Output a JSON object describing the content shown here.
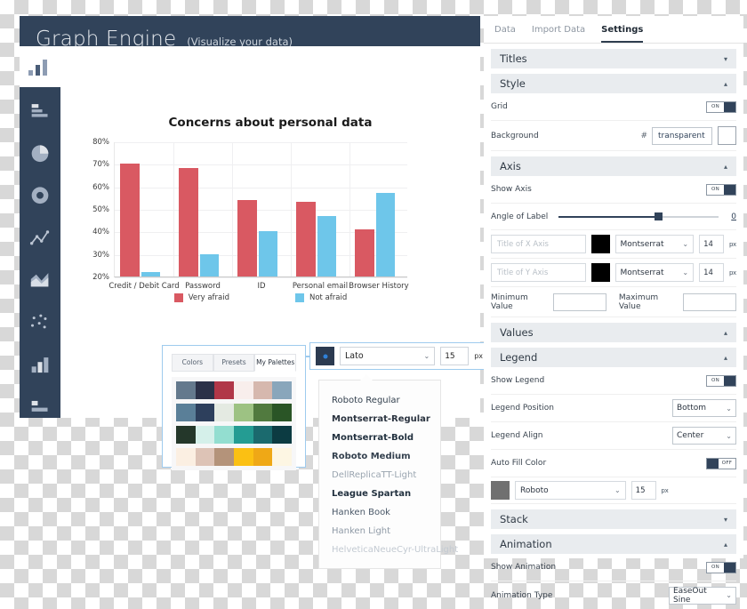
{
  "app": {
    "title": "Graph Engine",
    "subtitle": "(Visualize your data)",
    "sidebar_icons": [
      "bar-list-icon",
      "pie-chart-icon",
      "donut-chart-icon",
      "line-chart-icon",
      "area-chart-icon",
      "scatter-chart-icon",
      "column-chart-icon",
      "table-icon"
    ]
  },
  "chart_data": {
    "type": "bar",
    "title": "Concerns about personal data",
    "xlabel": "",
    "ylabel": "",
    "categories": [
      "Credit / Debit Card",
      "Password",
      "ID",
      "Personal email",
      "Browser History"
    ],
    "series": [
      {
        "name": "Very afraid",
        "color": "#d95962",
        "values": [
          70,
          68,
          54,
          53,
          41
        ]
      },
      {
        "name": "Not afraid",
        "color": "#6ec6ea",
        "values": [
          22,
          30,
          40,
          47,
          57
        ]
      }
    ],
    "ylim": [
      20,
      80
    ],
    "yticks": [
      "80%",
      "70%",
      "60%",
      "50%",
      "40%",
      "30%",
      "20%"
    ],
    "grid": true,
    "legend_position": "bottom",
    "legend_align": "center"
  },
  "palette_popup": {
    "tabs": [
      {
        "label": "Colors",
        "active": false
      },
      {
        "label": "Presets",
        "active": false
      },
      {
        "label": "My Palettes",
        "active": true
      }
    ],
    "rows": [
      [
        "#64798d",
        "#2b3148",
        "#b13748",
        "#f8eeec",
        "#d6b8ae",
        "#89a6bb"
      ],
      [
        "#5a7f98",
        "#2d3f5c",
        "#e4eae2",
        "#9dc283",
        "#517a3f",
        "#2a5526"
      ],
      [
        "#24372a",
        "#d5f0ea",
        "#93ded0",
        "#249c93",
        "#1b6a6e",
        "#0c3b42"
      ],
      [
        "#fbefe2",
        "#ddc3b6",
        "#b4937a",
        "#fbc013",
        "#efa816",
        "#fdf6e3"
      ]
    ]
  },
  "font_field": {
    "color": "#2b3a50",
    "font": "Lato",
    "size": "15",
    "unit": "px"
  },
  "font_list": [
    {
      "label": "Roboto Regular",
      "weight": "normal",
      "color": "#33404e"
    },
    {
      "label": "Montserrat-Regular",
      "weight": "bold",
      "color": "#2b3440"
    },
    {
      "label": "Montserrat-Bold",
      "weight": "bold",
      "color": "#22313f"
    },
    {
      "label": "Roboto Medium",
      "weight": "bold",
      "color": "#33404e"
    },
    {
      "label": "DellReplicaTT-Light",
      "weight": "normal",
      "color": "#9aa5b0"
    },
    {
      "label": "League Spartan",
      "weight": "bold",
      "color": "#22313f"
    },
    {
      "label": "Hanken Book",
      "weight": "normal",
      "color": "#4a5868"
    },
    {
      "label": "Hanken Light",
      "weight": "normal",
      "color": "#8f9aa6"
    },
    {
      "label": "HelveticaNeueCyr-UltraLight",
      "weight": "normal",
      "color": "#c3cad2"
    }
  ],
  "panel": {
    "tabs": [
      {
        "label": "Data",
        "active": false
      },
      {
        "label": "Import Data",
        "active": false
      },
      {
        "label": "Settings",
        "active": true
      }
    ],
    "sections": {
      "titles": {
        "label": "Titles",
        "caret": "▾"
      },
      "style": {
        "label": "Style",
        "caret": "▴"
      },
      "axis": {
        "label": "Axis",
        "caret": "▴"
      },
      "values": {
        "label": "Values",
        "caret": "▴"
      },
      "legend": {
        "label": "Legend",
        "caret": "▴"
      },
      "stack": {
        "label": "Stack",
        "caret": "▾"
      },
      "animation": {
        "label": "Animation",
        "caret": "▴"
      }
    },
    "style": {
      "grid_label": "Grid",
      "grid_toggle": "ON",
      "background_label": "Background",
      "hash": "#",
      "background_value": "transparent"
    },
    "axis": {
      "show_axis_label": "Show Axis",
      "show_axis_toggle": "ON",
      "angle_label": "Angle of Label",
      "angle_value": "0",
      "x_title_placeholder": "Title of X Axis",
      "x_font": "Montserrat",
      "x_size": "14",
      "x_unit": "px",
      "y_title_placeholder": "Title of Y Axis",
      "y_font": "Montserrat",
      "y_size": "14",
      "y_unit": "px",
      "min_label": "Minimum Value",
      "min_value": "",
      "max_label": "Maximum Value",
      "max_value": ""
    },
    "legend": {
      "show_label": "Show Legend",
      "show_toggle": "ON",
      "position_label": "Legend Position",
      "position_value": "Bottom",
      "align_label": "Legend Align",
      "align_value": "Center",
      "autofill_label": "Auto Fill Color",
      "autofill_toggle": "OFF",
      "font": "Roboto",
      "size": "15",
      "unit": "px"
    },
    "animation": {
      "show_label": "Show Animation",
      "show_toggle": "ON",
      "type_label": "Animation Type",
      "type_value": "EaseOut Sine"
    }
  }
}
